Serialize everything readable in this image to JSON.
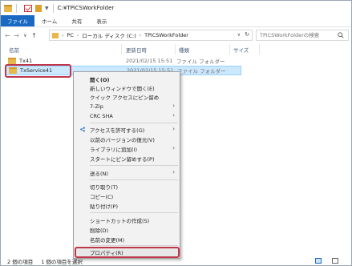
{
  "window": {
    "title": "C:¥TPiCSWorkFolder"
  },
  "ribbon": {
    "tabs": [
      "ファイル",
      "ホーム",
      "共有",
      "表示"
    ]
  },
  "address": {
    "crumbs": [
      "PC",
      "ローカル ディスク (C:)",
      "TPiCSWorkFolder"
    ]
  },
  "search": {
    "placeholder": "TPiCSWorkFolderの検索"
  },
  "columns": {
    "name": "名前",
    "date": "更新日時",
    "type": "種類",
    "size": "サイズ"
  },
  "files": [
    {
      "name": "Tx41",
      "date": "2021/02/15 15:51",
      "type": "ファイル フォルダー",
      "selected": false
    },
    {
      "name": "TxService41",
      "date": "2021/02/15 15:51",
      "type": "ファイル フォルダー",
      "selected": true
    }
  ],
  "context_menu": {
    "items": [
      {
        "label": "開く(O)",
        "bold": true
      },
      {
        "label": "新しいウィンドウで開く(E)"
      },
      {
        "label": "クイック アクセスにピン留め"
      },
      {
        "label": "7-Zip",
        "submenu": true
      },
      {
        "label": "CRC SHA",
        "submenu": true
      },
      {
        "label": "アクセスを許可する(G)",
        "submenu": true
      },
      {
        "label": "以前のバージョンの復元(V)"
      },
      {
        "label": "ライブラリに追加(I)",
        "submenu": true
      },
      {
        "label": "スタートにピン留めする(P)"
      },
      {
        "label": "送る(N)",
        "submenu": true
      },
      {
        "label": "切り取り(T)"
      },
      {
        "label": "コピー(C)"
      },
      {
        "label": "貼り付け(P)"
      },
      {
        "label": "ショートカットの作成(S)"
      },
      {
        "label": "削除(D)"
      },
      {
        "label": "名前の変更(M)"
      },
      {
        "label": "プロパティ(R)",
        "highlighted": true
      }
    ]
  },
  "status": {
    "item_count": "2 個の項目",
    "selected_count": "1 個の項目を選択"
  },
  "colors": {
    "accent": "#1a6ac4",
    "highlight_border": "#c0364a",
    "selection": "#cce8ff"
  }
}
